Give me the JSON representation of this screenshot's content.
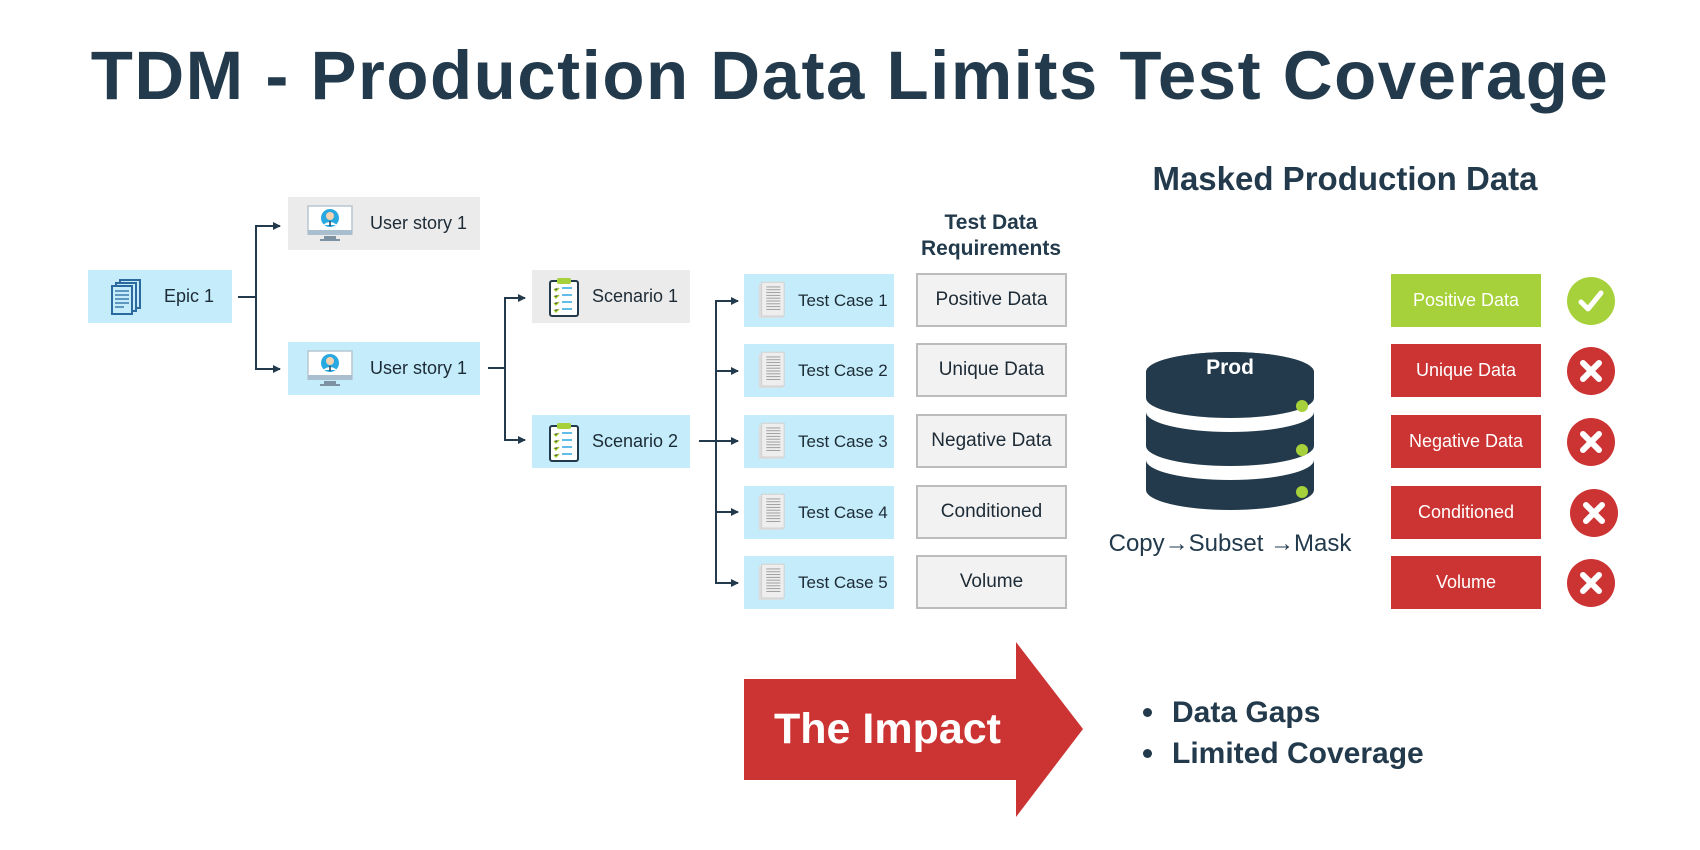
{
  "title": "TDM - Production Data Limits Test Coverage",
  "hierarchy": {
    "epic": {
      "label": "Epic 1",
      "icon": "documents-icon"
    },
    "user_stories": [
      {
        "label": "User story 1",
        "icon": "user-monitor-icon",
        "style": "gray"
      },
      {
        "label": "User story 1",
        "icon": "user-monitor-icon",
        "style": "blue"
      }
    ],
    "scenarios": [
      {
        "label": "Scenario 1",
        "icon": "clipboard-checklist-icon",
        "style": "gray"
      },
      {
        "label": "Scenario 2",
        "icon": "clipboard-checklist-icon",
        "style": "blue"
      }
    ],
    "test_cases": [
      {
        "label": "Test Case 1",
        "icon": "document-icon"
      },
      {
        "label": "Test Case 2",
        "icon": "document-icon"
      },
      {
        "label": "Test Case 3",
        "icon": "document-icon"
      },
      {
        "label": "Test Case 4",
        "icon": "document-icon"
      },
      {
        "label": "Test Case 5",
        "icon": "document-icon"
      }
    ]
  },
  "requirements": {
    "heading_line1": "Test Data",
    "heading_line2": "Requirements",
    "items": [
      "Positive Data",
      "Unique Data",
      "Negative Data",
      "Conditioned",
      "Volume"
    ]
  },
  "masked": {
    "heading": "Masked Production Data",
    "database_label": "Prod",
    "process": {
      "steps": [
        "Copy",
        "Subset",
        "Mask"
      ],
      "separator": "→"
    },
    "results": [
      {
        "label": "Positive Data",
        "status": "pass",
        "icon": "check-icon"
      },
      {
        "label": "Unique Data",
        "status": "fail",
        "icon": "x-icon"
      },
      {
        "label": "Negative Data",
        "status": "fail",
        "icon": "x-icon"
      },
      {
        "label": "Conditioned",
        "status": "fail",
        "icon": "x-icon"
      },
      {
        "label": "Volume",
        "status": "fail",
        "icon": "x-icon"
      }
    ]
  },
  "impact": {
    "label": "The Impact",
    "bullets": [
      "Data Gaps",
      "Limited Coverage"
    ]
  },
  "colors": {
    "navy": "#223a4b",
    "light_blue": "#c4ecfa",
    "gray": "#ebebeb",
    "pass_green": "#a6d13a",
    "fail_red": "#cc3333"
  }
}
